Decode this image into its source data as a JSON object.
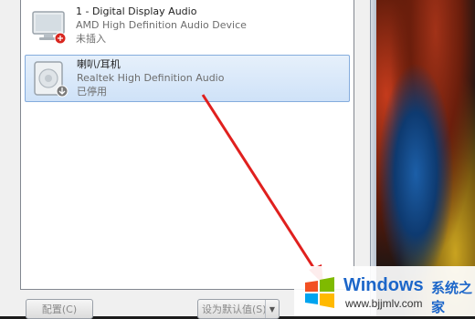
{
  "devices": [
    {
      "name": "1 - Digital Display Audio",
      "description": "AMD High Definition Audio Device",
      "status": "未插入",
      "icon": "monitor-icon",
      "status_icon": "unplugged-icon"
    },
    {
      "name": "喇叭/耳机",
      "description": "Realtek High Definition Audio",
      "status": "已停用",
      "icon": "speaker-icon",
      "status_icon": "disabled-icon"
    }
  ],
  "buttons": {
    "configure": "配置(C)",
    "set_default": "设为默认值(S)",
    "set_default_arrow": "▼"
  },
  "watermark": {
    "brand": "Windows",
    "brand_cn": "系统之家",
    "url": "www.bjjmlv.com"
  },
  "colors": {
    "selection": "#cfe2f8",
    "annotation_arrow": "#e0201e",
    "watermark_blue": "#1c66c9"
  }
}
